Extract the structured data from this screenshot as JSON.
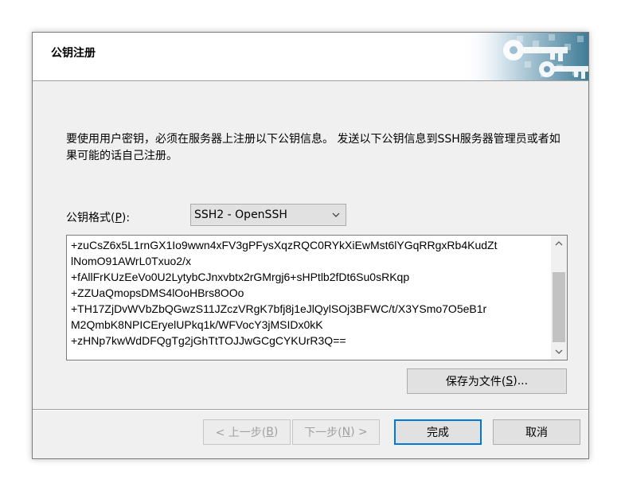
{
  "dialog": {
    "title": "公钥注册",
    "description": "要使用用户密钥，必须在服务器上注册以下公钥信息。 发送以下公钥信息到SSH服务器管理员或者如果可能的话自己注册。"
  },
  "format": {
    "label_prefix": "公钥格式(",
    "label_accel": "P",
    "label_suffix": "):",
    "selected": "SSH2 - OpenSSH"
  },
  "key_text": {
    "lines": [
      "+zuCsZ6x5L1rnGX1Io9wwn4xFV3gPFysXqzRQC0RYkXiEwMst6lYGqRRgxRb4KudZt",
      "lNomO91AWrL0Txuo2/x",
      "+fAllFrKUzEeVo0U2LytybCJnxvbtx2rGMrgj6+sHPtlb2fDt6Su0sRKqp",
      "+ZZUaQmopsDMS4lOoHBrs8OOo",
      "+TH17ZjDvWVbZbQGwzS11JZczVRgK7bfj8j1eJlQylSOj3BFWC/t/X3YSmo7O5eB1r",
      "M2QmbK8NPICEryelUPkq1k/WFVocY3jMSIDx0kK",
      "+zHNp7kwWdDFQgTg2jGhTtTOJJwGCgCYKUrR3Q=="
    ]
  },
  "buttons": {
    "save_prefix": "保存为文件(",
    "save_accel": "S",
    "save_suffix": ")...",
    "back_prefix": "< 上一步(",
    "back_accel": "B",
    "back_suffix": ")",
    "next_prefix": "下一步(",
    "next_accel": "N",
    "next_suffix": ") >",
    "finish": "完成",
    "cancel": "取消"
  },
  "colors": {
    "dialog_bg": "#f0f0f0",
    "accent_focus": "#0078d7",
    "disabled_text": "#a0a0a0"
  }
}
